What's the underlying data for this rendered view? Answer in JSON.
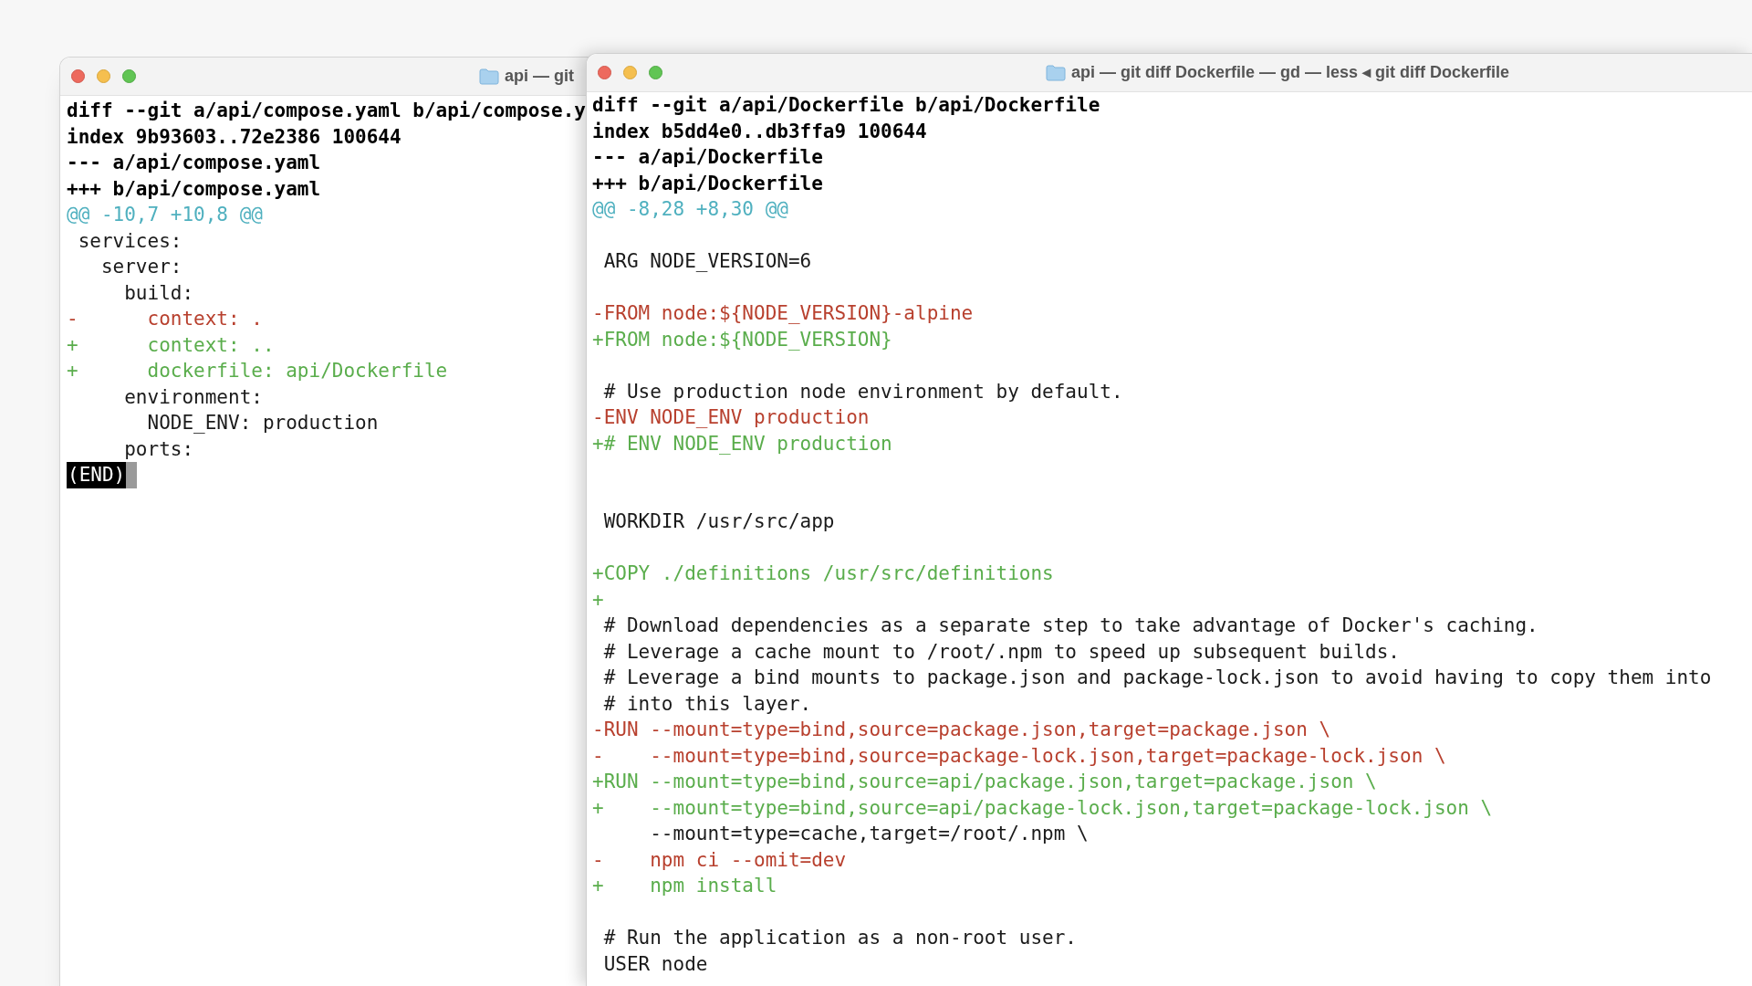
{
  "windows": [
    {
      "title": "api — git",
      "prompt": {
        "text": "(END)",
        "inverse": true
      },
      "lines": [
        {
          "kind": "header",
          "text": "diff --git a/api/compose.yaml b/api/compose.y"
        },
        {
          "kind": "header",
          "text": "index 9b93603..72e2386 100644"
        },
        {
          "kind": "header",
          "text": "--- a/api/compose.yaml"
        },
        {
          "kind": "header",
          "text": "+++ b/api/compose.yaml"
        },
        {
          "kind": "hunk",
          "text": "@@ -10,7 +10,8 @@"
        },
        {
          "kind": "context",
          "text": " services:"
        },
        {
          "kind": "context",
          "text": "   server:"
        },
        {
          "kind": "context",
          "text": "     build:"
        },
        {
          "kind": "removed",
          "text": "-      context: ."
        },
        {
          "kind": "added",
          "text": "+      context: .."
        },
        {
          "kind": "added",
          "text": "+      dockerfile: api/Dockerfile"
        },
        {
          "kind": "context",
          "text": "     environment:"
        },
        {
          "kind": "context",
          "text": "       NODE_ENV: production"
        },
        {
          "kind": "context",
          "text": "     ports:"
        }
      ]
    },
    {
      "title": "api — git diff Dockerfile — gd — less ◂ git diff Dockerfile",
      "lines": [
        {
          "kind": "header",
          "text": "diff --git a/api/Dockerfile b/api/Dockerfile"
        },
        {
          "kind": "header",
          "text": "index b5dd4e0..db3ffa9 100644"
        },
        {
          "kind": "header",
          "text": "--- a/api/Dockerfile"
        },
        {
          "kind": "header",
          "text": "+++ b/api/Dockerfile"
        },
        {
          "kind": "hunk",
          "text": "@@ -8,28 +8,30 @@"
        },
        {
          "kind": "blank"
        },
        {
          "kind": "context",
          "text": " ARG NODE_VERSION=6"
        },
        {
          "kind": "blank"
        },
        {
          "kind": "removed",
          "text": "-FROM node:${NODE_VERSION}-alpine"
        },
        {
          "kind": "added",
          "text": "+FROM node:${NODE_VERSION}"
        },
        {
          "kind": "blank"
        },
        {
          "kind": "context",
          "text": " # Use production node environment by default."
        },
        {
          "kind": "removed",
          "text": "-ENV NODE_ENV production"
        },
        {
          "kind": "added",
          "text": "+# ENV NODE_ENV production"
        },
        {
          "kind": "blank"
        },
        {
          "kind": "blank"
        },
        {
          "kind": "context",
          "text": " WORKDIR /usr/src/app"
        },
        {
          "kind": "blank"
        },
        {
          "kind": "added",
          "text": "+COPY ./definitions /usr/src/definitions"
        },
        {
          "kind": "added",
          "text": "+"
        },
        {
          "kind": "context",
          "text": " # Download dependencies as a separate step to take advantage of Docker's caching."
        },
        {
          "kind": "context",
          "text": " # Leverage a cache mount to /root/.npm to speed up subsequent builds."
        },
        {
          "kind": "context",
          "text": " # Leverage a bind mounts to package.json and package-lock.json to avoid having to copy them into"
        },
        {
          "kind": "context",
          "text": " # into this layer."
        },
        {
          "kind": "removed",
          "text": "-RUN --mount=type=bind,source=package.json,target=package.json \\"
        },
        {
          "kind": "removed",
          "text": "-    --mount=type=bind,source=package-lock.json,target=package-lock.json \\"
        },
        {
          "kind": "added",
          "text": "+RUN --mount=type=bind,source=api/package.json,target=package.json \\"
        },
        {
          "kind": "added",
          "text": "+    --mount=type=bind,source=api/package-lock.json,target=package-lock.json \\"
        },
        {
          "kind": "context",
          "text": "     --mount=type=cache,target=/root/.npm \\"
        },
        {
          "kind": "removed",
          "text": "-    npm ci --omit=dev"
        },
        {
          "kind": "added",
          "text": "+    npm install"
        },
        {
          "kind": "blank"
        },
        {
          "kind": "context",
          "text": " # Run the application as a non-root user."
        },
        {
          "kind": "context",
          "text": " USER node"
        }
      ]
    }
  ]
}
